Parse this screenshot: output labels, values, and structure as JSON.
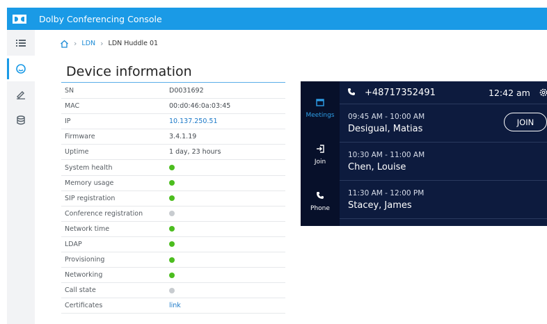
{
  "app": {
    "title": "Dolby Conferencing Console"
  },
  "rail": {
    "items": [
      "list-icon",
      "dashboard-icon",
      "edit-icon",
      "database-icon"
    ],
    "active": 1
  },
  "breadcrumb": {
    "home_icon": "home-icon",
    "items": [
      "LDN",
      "LDN Huddle 01"
    ]
  },
  "page": {
    "title": "Device information"
  },
  "info": {
    "rows": [
      {
        "label": "SN",
        "value": "D0031692"
      },
      {
        "label": "MAC",
        "value": "00:d0:46:0a:03:45"
      },
      {
        "label": "IP",
        "value": "10.137.250.51"
      },
      {
        "label": "Firmware",
        "value": "3.4.1.19"
      },
      {
        "label": "Uptime",
        "value": "1 day, 23 hours"
      },
      {
        "label": "System health",
        "status": "green"
      },
      {
        "label": "Memory usage",
        "status": "green"
      },
      {
        "label": "SIP registration",
        "status": "green"
      },
      {
        "label": "Conference registration",
        "status": "grey"
      },
      {
        "label": "Network time",
        "status": "green"
      },
      {
        "label": "LDAP",
        "status": "green"
      },
      {
        "label": "Provisioning",
        "status": "green"
      },
      {
        "label": "Networking",
        "status": "green"
      },
      {
        "label": "Call state",
        "status": "grey"
      },
      {
        "label": "Certificates",
        "value": "link"
      }
    ]
  },
  "panel": {
    "phone_number": "+48717352491",
    "time": "12:42 am",
    "side": {
      "meetings": "Meetings",
      "join": "Join",
      "phone": "Phone"
    },
    "join_label": "JOIN",
    "meetings": [
      {
        "time": "09:45 AM - 10:00 AM",
        "name": "Desigual, Matias"
      },
      {
        "time": "10:30 AM - 11:00 AM",
        "name": "Chen, Louise"
      },
      {
        "time": "11:30 AM - 12:00 PM",
        "name": "Stacey, James"
      }
    ]
  },
  "colors": {
    "accent": "#1a9ae6",
    "panel_bg": "#0d1b3e",
    "status_green": "#4cbd1f",
    "status_grey": "#c8ccd0"
  }
}
